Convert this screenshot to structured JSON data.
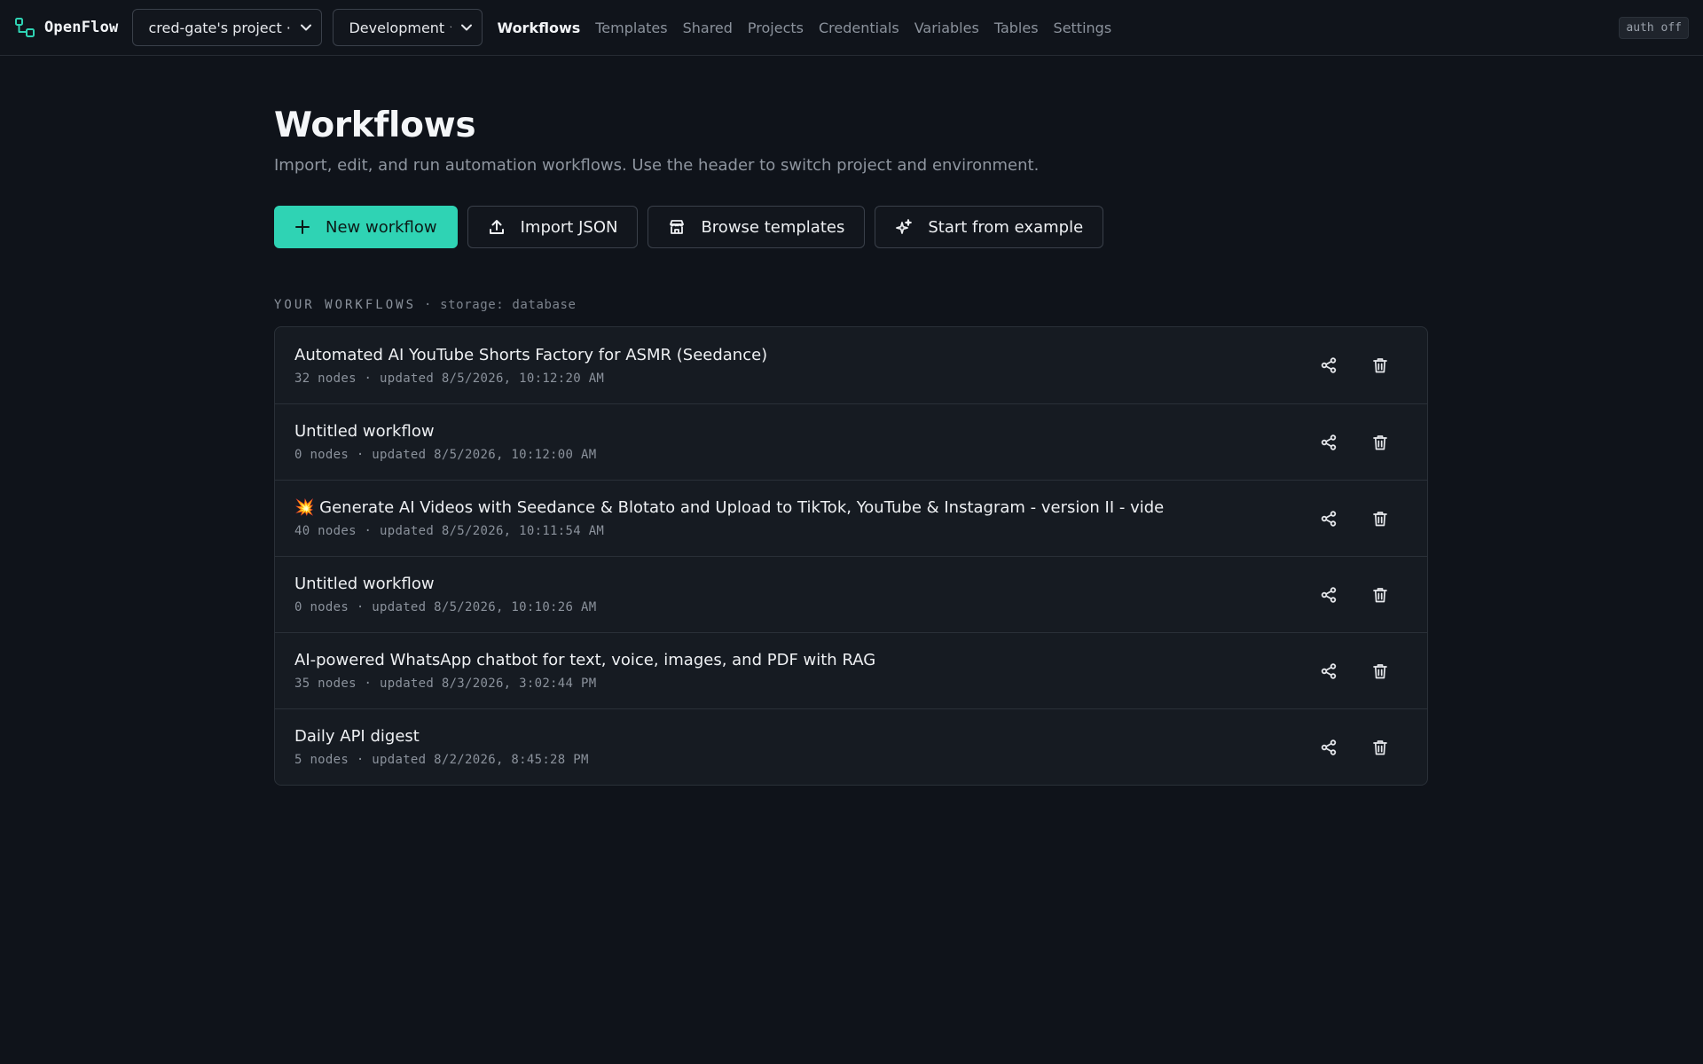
{
  "app": {
    "name": "OpenFlow",
    "logo_icon": "nodes-logo-icon",
    "accent_color": "#2fd3b4"
  },
  "header": {
    "project_select": {
      "value": "cred-gate's project · pe"
    },
    "env_select": {
      "value": "Development ★"
    },
    "nav": [
      {
        "label": "Workflows",
        "active": true
      },
      {
        "label": "Templates",
        "active": false
      },
      {
        "label": "Shared",
        "active": false
      },
      {
        "label": "Projects",
        "active": false
      },
      {
        "label": "Credentials",
        "active": false
      },
      {
        "label": "Variables",
        "active": false
      },
      {
        "label": "Tables",
        "active": false
      },
      {
        "label": "Settings",
        "active": false
      }
    ],
    "auth_badge": "auth off"
  },
  "page": {
    "title": "Workflows",
    "subtitle": "Import, edit, and run automation workflows. Use the header to switch project and environment."
  },
  "actions": {
    "new_workflow": "New workflow",
    "import_json": "Import JSON",
    "browse_templates": "Browse templates",
    "start_from_example": "Start from example"
  },
  "workflows_section": {
    "label": "YOUR WORKFLOWS",
    "meta": " · storage: database"
  },
  "workflows": [
    {
      "title": "Automated AI YouTube Shorts Factory for ASMR (Seedance)",
      "meta": "32 nodes · updated 8/5/2026, 10:12:20 AM"
    },
    {
      "title": "Untitled workflow",
      "meta": "0 nodes · updated 8/5/2026, 10:12:00 AM"
    },
    {
      "title": "💥 Generate AI Videos with Seedance & Blotato and Upload to TikTok, YouTube & Instagram - version II - vide",
      "meta": "40 nodes · updated 8/5/2026, 10:11:54 AM"
    },
    {
      "title": "Untitled workflow",
      "meta": "0 nodes · updated 8/5/2026, 10:10:26 AM"
    },
    {
      "title": "AI-powered WhatsApp chatbot for text, voice, images, and PDF with RAG",
      "meta": "35 nodes · updated 8/3/2026, 3:02:44 PM"
    },
    {
      "title": "Daily API digest",
      "meta": "5 nodes · updated 8/2/2026, 8:45:28 PM"
    }
  ]
}
